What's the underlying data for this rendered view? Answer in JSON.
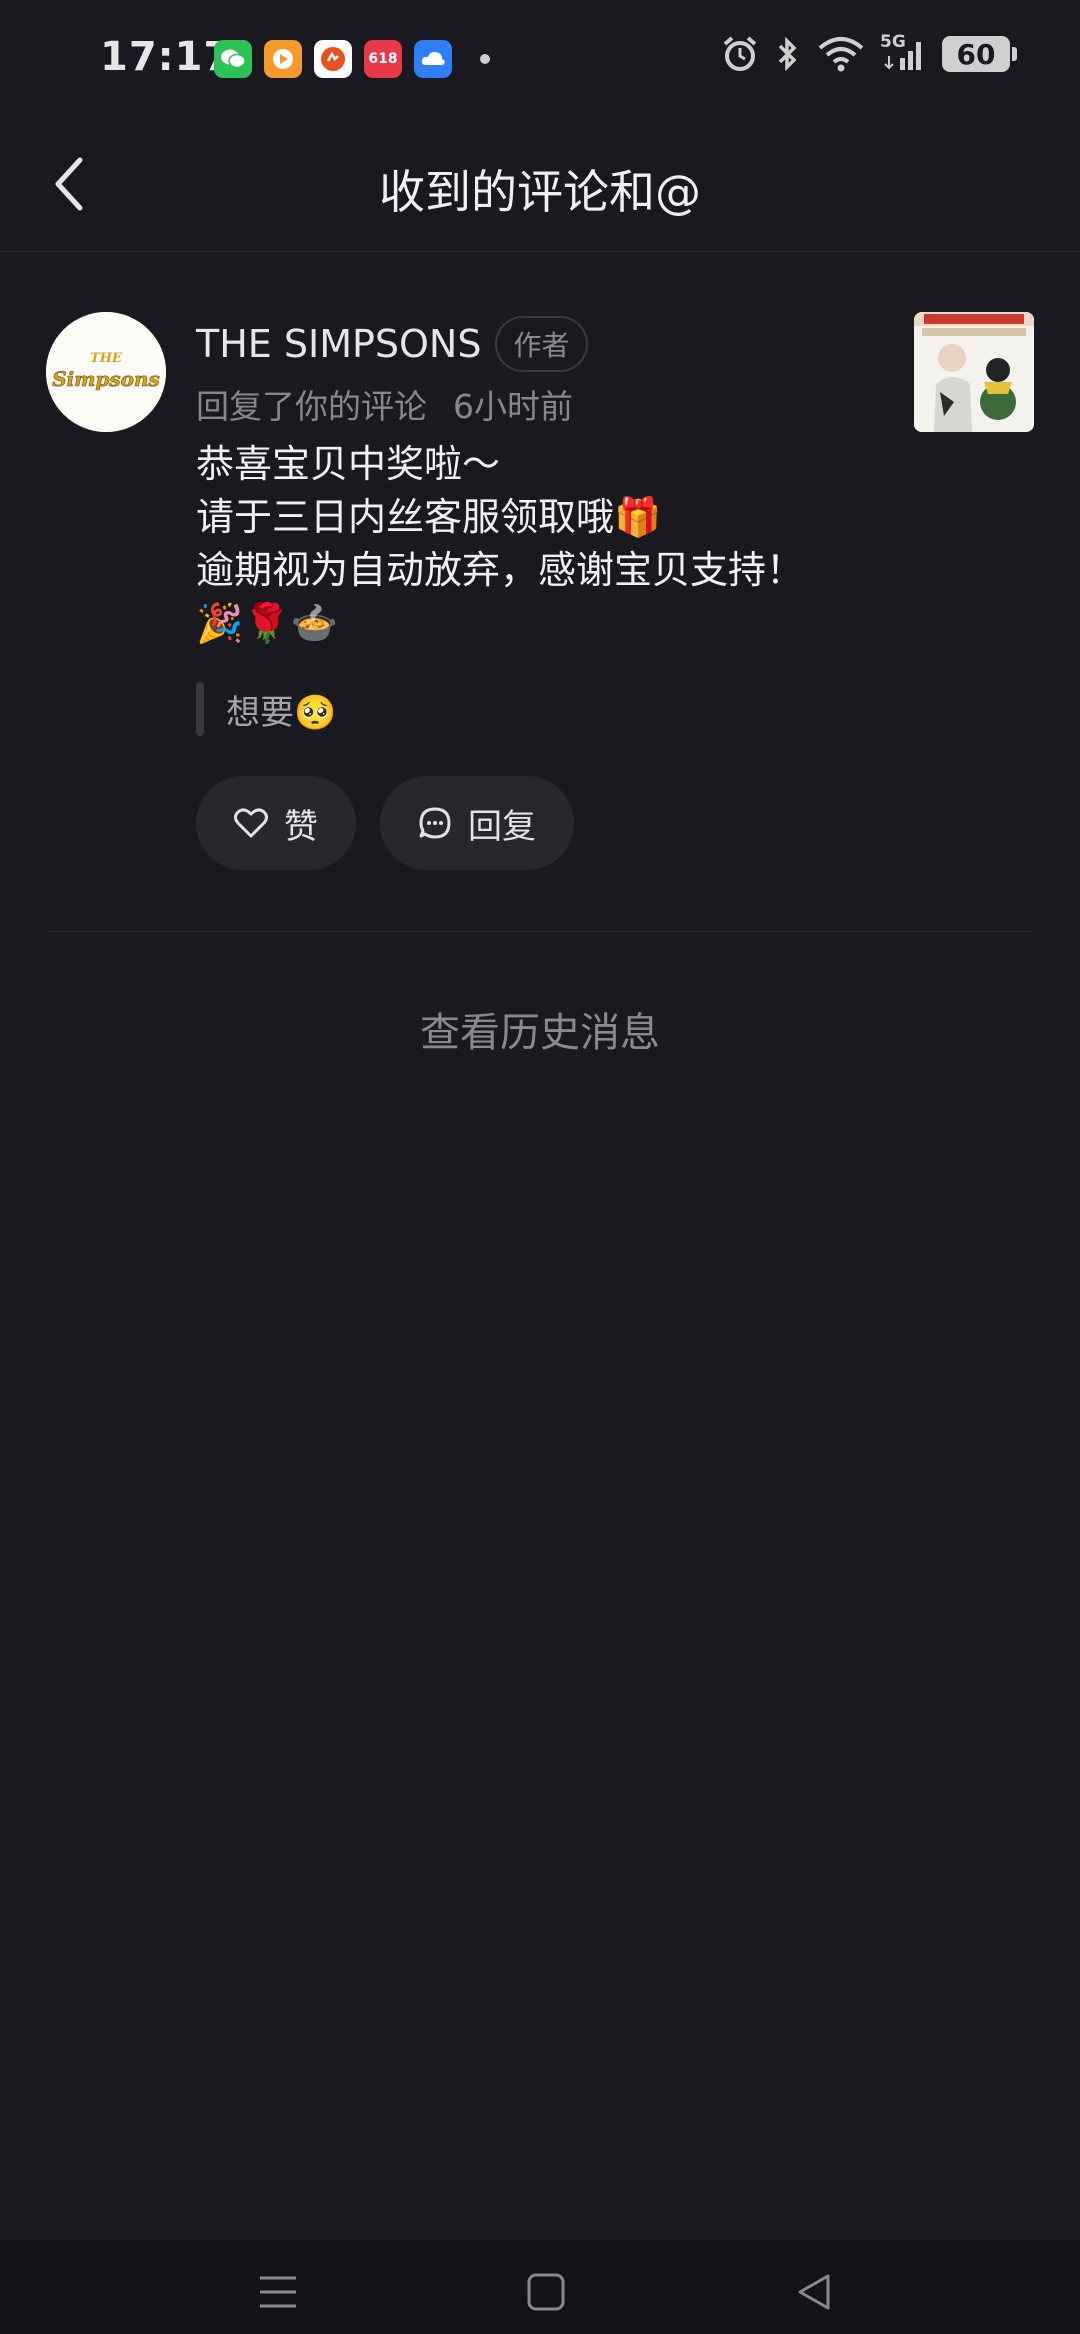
{
  "status_bar": {
    "time": "17:17",
    "notification_apps": [
      {
        "name": "wechat-icon",
        "color": "#2dc158",
        "glyph": ""
      },
      {
        "name": "video-app-icon",
        "color": "#f59a2b",
        "glyph": "▶"
      },
      {
        "name": "shopping-app-icon",
        "color": "#ffffff",
        "glyph": ""
      },
      {
        "name": "promo-618-app-icon",
        "color": "#e8384a",
        "glyph": "618"
      },
      {
        "name": "cloud-app-icon",
        "color": "#2f7ef5",
        "glyph": ""
      }
    ],
    "network": "5G",
    "battery": "60"
  },
  "header": {
    "title": "收到的评论和@"
  },
  "message": {
    "username": "THE SIMPSONS",
    "author_badge": "作者",
    "action_text": "回复了你的评论",
    "time_ago": "6小时前",
    "body_lines": [
      "恭喜宝贝中奖啦～",
      "请于三日内丝客服领取哦🎁",
      "逾期视为自动放弃，感谢宝贝支持！",
      "🎉🌹🍲"
    ],
    "quoted_comment": "想要🥺",
    "like_label": "赞",
    "reply_label": "回复"
  },
  "history_link": "查看历史消息"
}
